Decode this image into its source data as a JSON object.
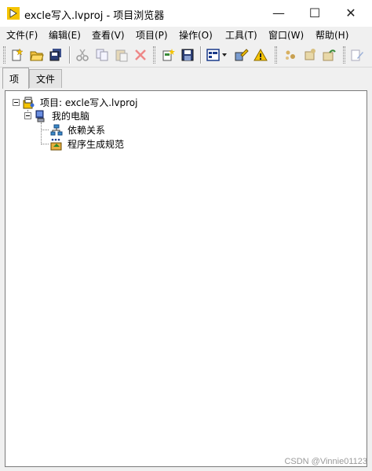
{
  "window": {
    "title": "excle写入.lvproj - 项目浏览器",
    "minimize_glyph": "—",
    "maximize_glyph": "☐",
    "close_glyph": "✕"
  },
  "menu": [
    {
      "label": "文件(F)"
    },
    {
      "label": "编辑(E)"
    },
    {
      "label": "查看(V)"
    },
    {
      "label": "项目(P)"
    },
    {
      "label": "操作(O)"
    },
    {
      "label": "工具(T)"
    },
    {
      "label": "窗口(W)"
    },
    {
      "label": "帮助(H)"
    }
  ],
  "toolbar": {
    "icons": [
      "new-file-icon",
      "open-folder-icon",
      "save-all-icon",
      "cut-icon",
      "copy-icon",
      "paste-icon",
      "delete-icon",
      "add-files-icon",
      "save-icon",
      "view-options-icon",
      "properties-icon",
      "warning-icon",
      "gear-tools-icon",
      "build-icon",
      "deploy-icon",
      "edit-icon"
    ]
  },
  "tabs": [
    {
      "label": "项",
      "active": true
    },
    {
      "label": "文件",
      "active": false
    }
  ],
  "tree": {
    "root": {
      "label": "项目: excle写入.lvproj"
    },
    "computer": {
      "label": "我的电脑"
    },
    "dependencies": {
      "label": "依赖关系"
    },
    "build_specs": {
      "label": "程序生成规范"
    }
  },
  "watermark": "CSDN @Vinnie01123",
  "colors": {
    "chrome_bg": "#f0f0f0",
    "tree_bg": "#ffffff",
    "accent_yellow": "#f5c400"
  }
}
